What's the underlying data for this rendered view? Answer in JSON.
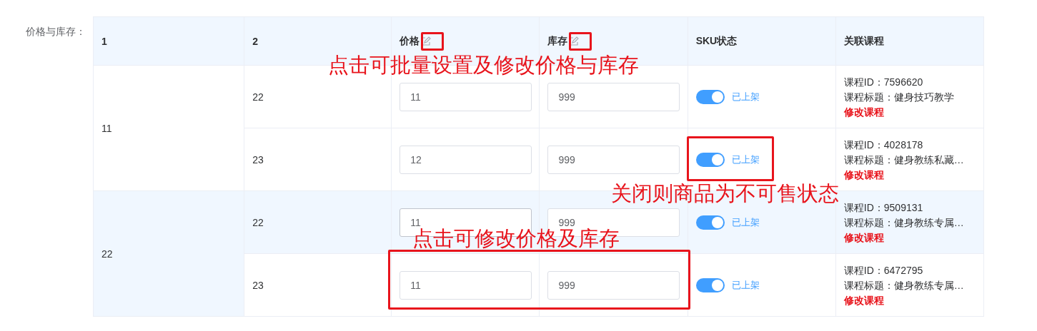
{
  "field_label": "价格与库存：",
  "table": {
    "columns": [
      {
        "label": "1",
        "editable": false
      },
      {
        "label": "2",
        "editable": false
      },
      {
        "label": "价格",
        "editable": true
      },
      {
        "label": "库存",
        "editable": true
      },
      {
        "label": "SKU状态",
        "editable": false
      },
      {
        "label": "关联课程",
        "editable": false
      }
    ],
    "groups": [
      {
        "value": "11",
        "rows": [
          {
            "value": "22",
            "price": "11",
            "stock": "999",
            "on": true,
            "status": "已上架",
            "hovered": false,
            "course": {
              "id_line": "课程ID：7596620",
              "title_line": "课程标题：健身技巧教学",
              "action": "修改课程"
            }
          },
          {
            "value": "23",
            "price": "12",
            "stock": "999",
            "on": true,
            "status": "已上架",
            "hovered": false,
            "course": {
              "id_line": "课程ID：4028178",
              "title_line": "课程标题：健身教练私藏…",
              "action": "修改课程"
            }
          }
        ]
      },
      {
        "value": "22",
        "rows": [
          {
            "value": "22",
            "price": "11",
            "stock": "999",
            "on": true,
            "status": "已上架",
            "hovered": true,
            "course": {
              "id_line": "课程ID：9509131",
              "title_line": "课程标题：健身教练专属…",
              "action": "修改课程"
            }
          },
          {
            "value": "23",
            "price": "11",
            "stock": "999",
            "on": true,
            "status": "已上架",
            "hovered": false,
            "course": {
              "id_line": "课程ID：6472795",
              "title_line": "课程标题：健身教练专属…",
              "action": "修改课程"
            }
          }
        ]
      }
    ]
  },
  "annotations": [
    {
      "text": "点击可批量设置及修改价格与库存"
    },
    {
      "text": "关闭则商品为不可售状态"
    },
    {
      "text": "点击可修改价格及库存"
    }
  ]
}
